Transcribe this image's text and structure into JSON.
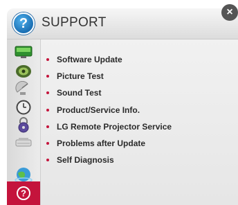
{
  "header": {
    "title": "SUPPORT",
    "icon": "support-question-icon",
    "close_symbol": "×"
  },
  "sidebar": {
    "items": [
      {
        "icon": "picture-monitor-icon"
      },
      {
        "icon": "sound-speaker-icon"
      },
      {
        "icon": "satellite-dish-icon"
      },
      {
        "icon": "clock-time-icon"
      },
      {
        "icon": "lock-icon"
      },
      {
        "icon": "projector-option-icon"
      },
      {
        "icon": "network-globe-icon"
      },
      {
        "icon": "support-question-icon",
        "active": true
      }
    ]
  },
  "menu": {
    "items": [
      {
        "label": "Software Update"
      },
      {
        "label": "Picture Test"
      },
      {
        "label": "Sound Test"
      },
      {
        "label": "Product/Service Info."
      },
      {
        "label": "LG Remote Projector Service"
      },
      {
        "label": "Problems after Update"
      },
      {
        "label": "Self Diagnosis"
      }
    ]
  },
  "colors": {
    "accent": "#c4143c",
    "header_icon_blue": "#1b6fb3"
  }
}
